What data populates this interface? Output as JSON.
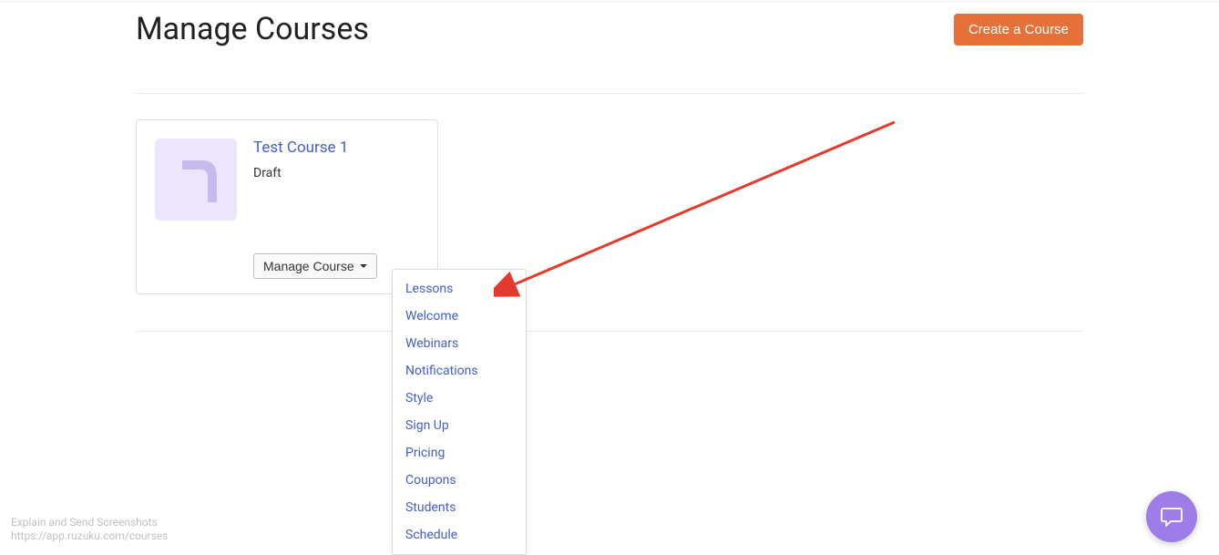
{
  "page": {
    "title": "Manage Courses",
    "create_button": "Create a Course"
  },
  "course": {
    "title": "Test Course 1",
    "status": "Draft",
    "manage_label": "Manage Course"
  },
  "dropdown": {
    "items": [
      "Lessons",
      "Welcome",
      "Webinars",
      "Notifications",
      "Style",
      "Sign Up",
      "Pricing",
      "Coupons",
      "Students",
      "Schedule"
    ]
  },
  "footer": {
    "line1": "Explain and Send Screenshots",
    "line2": "https://app.ruzuku.com/courses"
  }
}
